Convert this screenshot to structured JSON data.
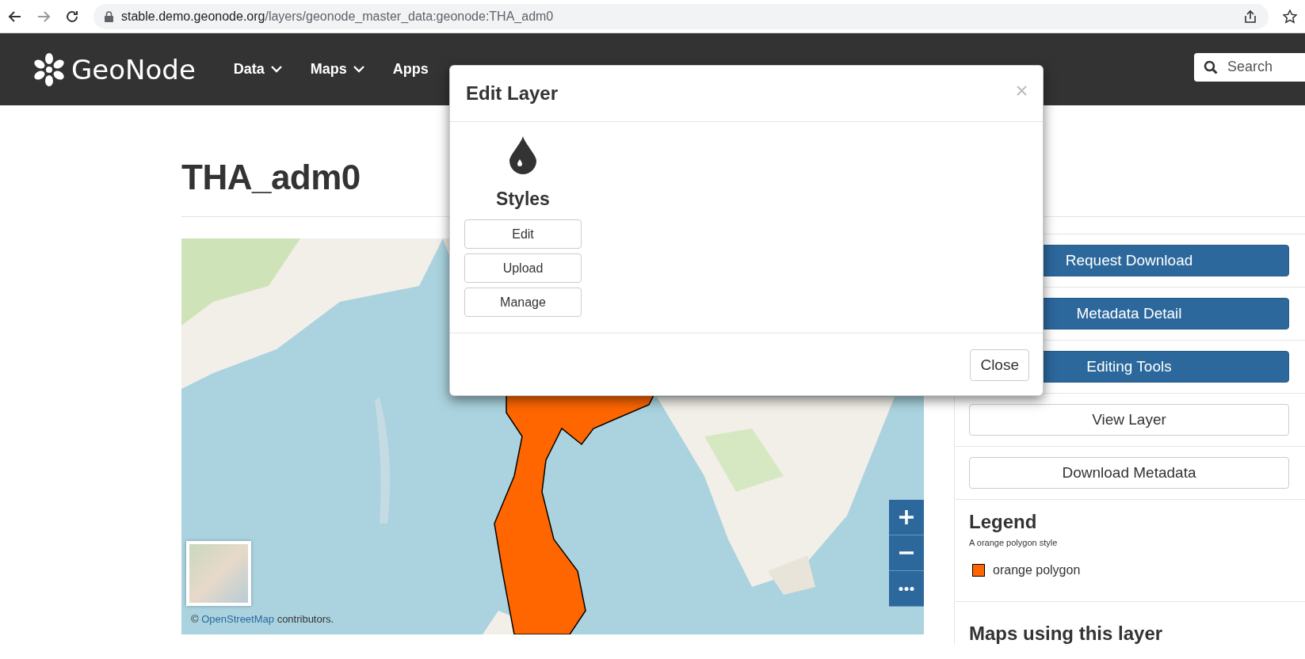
{
  "browser": {
    "url_host": "stable.demo.geonode.org",
    "url_path": "/layers/geonode_master_data:geonode:THA_adm0"
  },
  "navbar": {
    "logo": "GeoNode",
    "items": [
      {
        "label": "Data",
        "dropdown": true
      },
      {
        "label": "Maps",
        "dropdown": true
      },
      {
        "label": "Apps",
        "dropdown": false
      }
    ],
    "search": {
      "placeholder": "Search"
    }
  },
  "page": {
    "title": "THA_adm0"
  },
  "map": {
    "kind": "picture",
    "attribution_prefix": "©",
    "attribution_link": "OpenStreetMap",
    "attribution_suffix": "contributors."
  },
  "actions": [
    {
      "label": "Request Download",
      "kind": "primary"
    },
    {
      "label": "Metadata Detail",
      "kind": "primary"
    },
    {
      "label": "Editing Tools",
      "kind": "primary"
    },
    {
      "label": "View Layer",
      "kind": "default"
    },
    {
      "label": "Download Metadata",
      "kind": "default"
    }
  ],
  "legend": {
    "title": "Legend",
    "subtitle": "A orange polygon style",
    "items": [
      {
        "label": "orange polygon",
        "color": "#ff6600"
      }
    ]
  },
  "maps_heading": "Maps using this layer",
  "modal": {
    "title": "Edit Layer",
    "section": "Styles",
    "buttons": [
      "Edit",
      "Upload",
      "Manage"
    ],
    "footer_button": "Close"
  }
}
